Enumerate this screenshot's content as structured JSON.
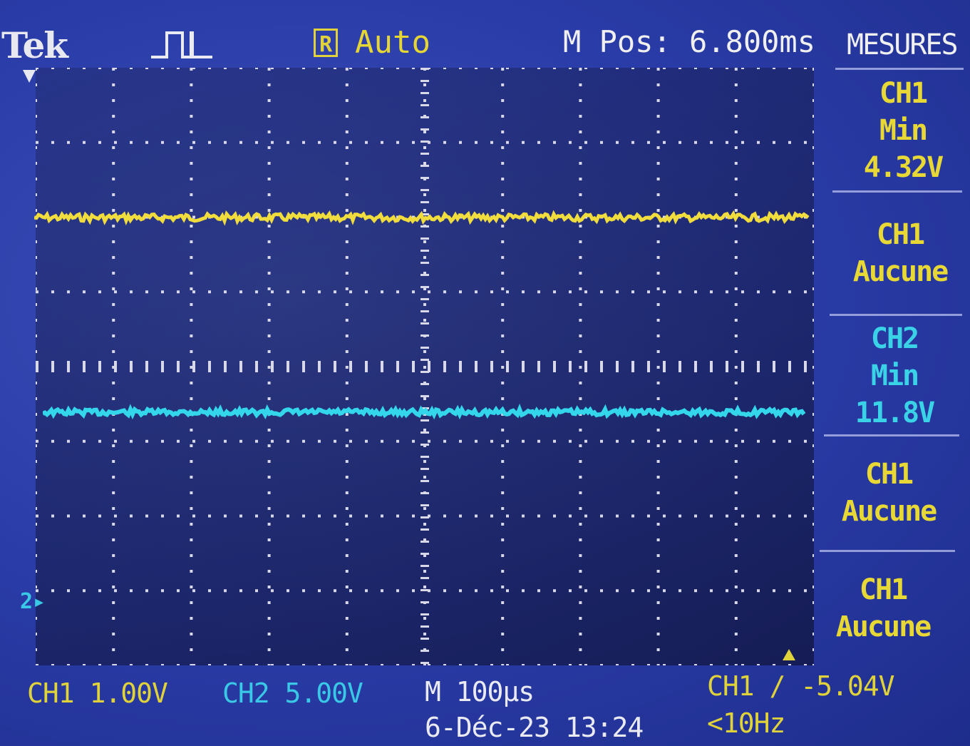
{
  "header": {
    "brand": "Tek",
    "run_status_icon": "R",
    "trigger_mode": "Auto",
    "horizontal_position": "M Pos: 6.800ms",
    "menu_title": "MESURES"
  },
  "measurements": [
    {
      "source": "CH1",
      "type": "Min",
      "value": "4.32V"
    },
    {
      "source": "CH1",
      "type": "Aucune",
      "value": ""
    },
    {
      "source": "CH2",
      "type": "Min",
      "value": "11.8V"
    },
    {
      "source": "CH1",
      "type": "Aucune",
      "value": ""
    },
    {
      "source": "CH1",
      "type": "Aucune",
      "value": ""
    }
  ],
  "footer": {
    "ch1_scale": "CH1  1.00V",
    "ch2_scale": "CH2  5.00V",
    "timebase": "M 100µs",
    "date_time": "6-Déc-23 13:24",
    "trigger": "CH1 ∕ -5.04V",
    "frequency": "<10Hz"
  },
  "markers": {
    "trigger_position_icon": "down-arrow-icon",
    "ch2_ground_marker": "2▸"
  },
  "colors": {
    "ch1": "#e0d23a",
    "ch2": "#39c8e6",
    "background": "#2a3a9e"
  }
}
